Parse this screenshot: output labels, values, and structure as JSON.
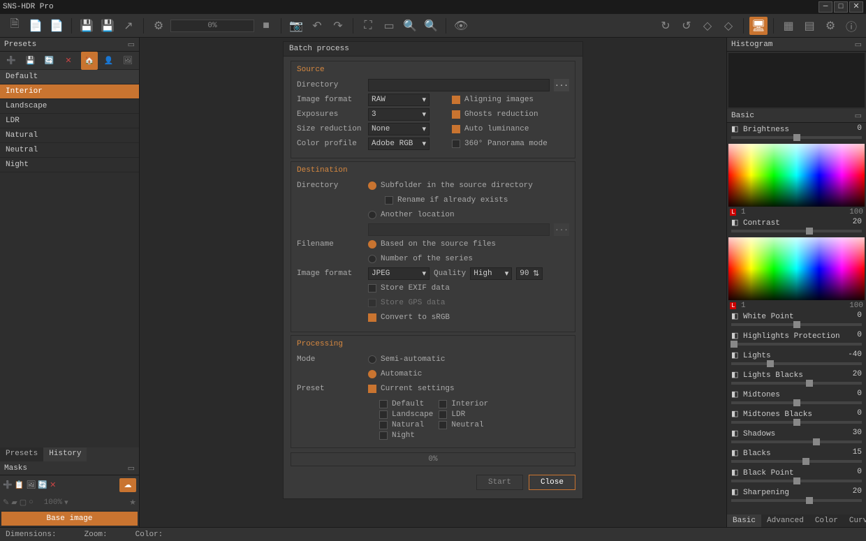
{
  "app": {
    "title": "SNS-HDR Pro"
  },
  "toolbar": {
    "progress": "0%"
  },
  "panels": {
    "presets": {
      "title": "Presets",
      "items": [
        "Default",
        "Interior",
        "Landscape",
        "LDR",
        "Natural",
        "Neutral",
        "Night"
      ],
      "selected": "Interior",
      "tabs": [
        "Presets",
        "History"
      ]
    },
    "masks": {
      "title": "Masks",
      "zoom": "100%",
      "base_image": "Base image"
    },
    "histogram": {
      "title": "Histogram"
    },
    "basic": {
      "title": "Basic",
      "sliders": [
        {
          "name": "Brightness",
          "value": 0,
          "pos": 50
        },
        {
          "name": "Contrast",
          "value": 20,
          "pos": 60
        }
      ],
      "sliders2": [
        {
          "name": "White Point",
          "value": 0,
          "pos": 50
        },
        {
          "name": "Highlights Protection",
          "value": 0,
          "pos": 2
        },
        {
          "name": "Lights",
          "value": -40,
          "pos": 30
        },
        {
          "name": "Lights Blacks",
          "value": 20,
          "pos": 60
        },
        {
          "name": "Midtones",
          "value": 0,
          "pos": 50
        },
        {
          "name": "Midtones Blacks",
          "value": 0,
          "pos": 50
        },
        {
          "name": "Shadows",
          "value": 30,
          "pos": 65
        },
        {
          "name": "Blacks",
          "value": 15,
          "pos": 57
        },
        {
          "name": "Black Point",
          "value": 0,
          "pos": 50
        },
        {
          "name": "Sharpening",
          "value": 20,
          "pos": 60
        }
      ],
      "l_scale": {
        "min": "1",
        "max": "100"
      },
      "tabs": [
        "Basic",
        "Advanced",
        "Color",
        "Curves"
      ]
    }
  },
  "dialog": {
    "title": "Batch process",
    "source": {
      "title": "Source",
      "labels": {
        "directory": "Directory",
        "image_format": "Image format",
        "exposures": "Exposures",
        "size_reduction": "Size reduction",
        "color_profile": "Color profile"
      },
      "values": {
        "image_format": "RAW",
        "exposures": "3",
        "size_reduction": "None",
        "color_profile": "Adobe RGB"
      },
      "options": {
        "aligning": "Aligning images",
        "ghosts": "Ghosts reduction",
        "auto_luminance": "Auto luminance",
        "panorama": "360° Panorama mode"
      }
    },
    "destination": {
      "title": "Destination",
      "labels": {
        "directory": "Directory",
        "filename": "Filename",
        "image_format": "Image format",
        "quality": "Quality"
      },
      "dir_options": {
        "subfolder": "Subfolder in the source directory",
        "rename": "Rename if already exists",
        "another": "Another location"
      },
      "filename_options": {
        "based": "Based on the source files",
        "number": "Number of the series"
      },
      "values": {
        "image_format": "JPEG",
        "quality": "High",
        "quality_val": "90"
      },
      "options": {
        "exif": "Store EXIF data",
        "gps": "Store GPS data",
        "srgb": "Convert to sRGB"
      }
    },
    "processing": {
      "title": "Processing",
      "labels": {
        "mode": "Mode",
        "preset": "Preset"
      },
      "mode_options": {
        "semi": "Semi-automatic",
        "auto": "Automatic"
      },
      "current": "Current settings",
      "presets": [
        "Default",
        "Interior",
        "Landscape",
        "LDR",
        "Natural",
        "Neutral",
        "Night"
      ]
    },
    "progress": "0%",
    "buttons": {
      "start": "Start",
      "close": "Close"
    }
  },
  "status": {
    "dimensions": "Dimensions:",
    "zoom": "Zoom:",
    "color": "Color:"
  }
}
